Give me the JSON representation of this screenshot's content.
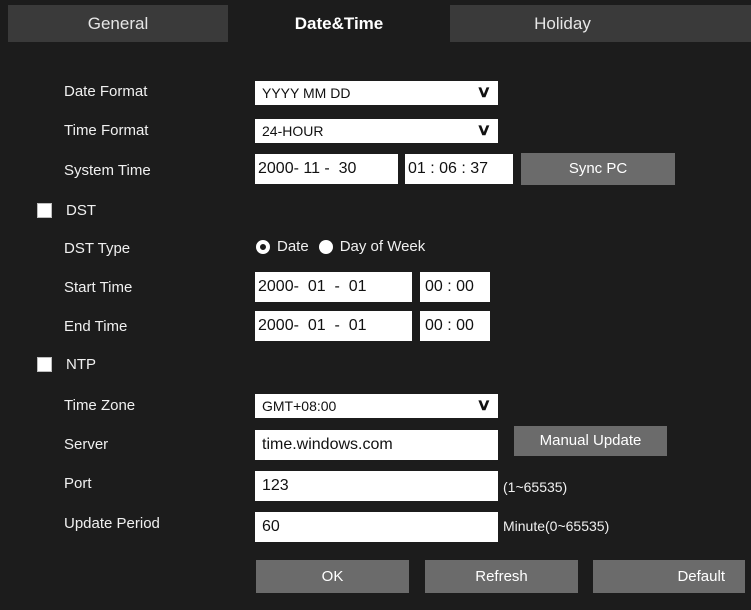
{
  "tabs": [
    {
      "label": "General"
    },
    {
      "label": "Date&Time"
    },
    {
      "label": "Holiday"
    }
  ],
  "form": {
    "date_format": {
      "label": "Date Format",
      "value": "YYYY MM DD"
    },
    "time_format": {
      "label": "Time Format",
      "value": "24-HOUR"
    },
    "system_time": {
      "label": "System Time",
      "date": "2000- 11 -  30",
      "time": "01 : 06 : 37",
      "sync_button": "Sync PC"
    },
    "dst": {
      "label": "DST",
      "checked": false
    },
    "dst_type": {
      "label": "DST Type",
      "option_date": "Date",
      "option_week": "Day of Week",
      "selected": "Date"
    },
    "start_time": {
      "label": "Start Time",
      "date": "2000-  01  -  01",
      "time": "00 : 00"
    },
    "end_time": {
      "label": "End Time",
      "date": "2000-  01  -  01",
      "time": "00 : 00"
    },
    "ntp": {
      "label": "NTP",
      "checked": false
    },
    "time_zone": {
      "label": "Time Zone",
      "value": "GMT+08:00"
    },
    "server": {
      "label": "Server",
      "value": "time.windows.com",
      "button": "Manual Update"
    },
    "port": {
      "label": "Port",
      "value": "123",
      "hint": "(1~65535)"
    },
    "update_period": {
      "label": "Update Period",
      "value": "60",
      "hint": "Minute(0~65535)"
    }
  },
  "footer": {
    "ok": "OK",
    "refresh": "Refresh",
    "default": "Default"
  },
  "icons": {
    "dropdown": "chevron-down-icon",
    "checkbox": "checkbox-icon",
    "radio": "radio-icon"
  }
}
